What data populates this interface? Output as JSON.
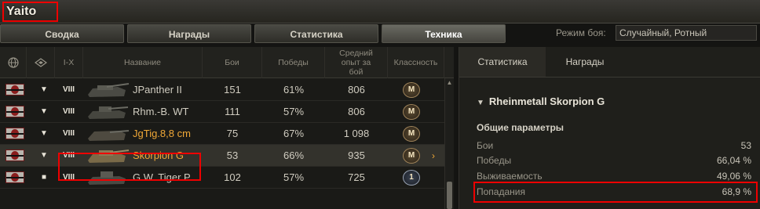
{
  "player": {
    "name": "Yaito"
  },
  "tabs": [
    {
      "label": "Сводка"
    },
    {
      "label": "Награды"
    },
    {
      "label": "Статистика"
    },
    {
      "label": "Техника"
    }
  ],
  "battle_mode": {
    "label": "Режим боя:",
    "value": "Случайный, Ротный"
  },
  "table": {
    "headers": {
      "tier": "I-X",
      "name": "Название",
      "battles": "Бои",
      "wins": "Победы",
      "avg_xp": "Средний опыт за бой",
      "mastery": "Классность"
    },
    "rows": [
      {
        "tier": "VIII",
        "name": "JPanther II",
        "battles": "151",
        "wins": "61%",
        "avg_xp": "806",
        "mastery": "M",
        "premium": false,
        "expand_icon": "triangle-down"
      },
      {
        "tier": "VIII",
        "name": "Rhm.-B. WT",
        "battles": "111",
        "wins": "57%",
        "avg_xp": "806",
        "mastery": "M",
        "premium": false,
        "expand_icon": "triangle-down"
      },
      {
        "tier": "VIII",
        "name": "JgTig.8,8 cm",
        "battles": "75",
        "wins": "67%",
        "avg_xp": "1 098",
        "mastery": "M",
        "premium": true,
        "expand_icon": "triangle-down"
      },
      {
        "tier": "VIII",
        "name": "Skorpion G",
        "battles": "53",
        "wins": "66%",
        "avg_xp": "935",
        "mastery": "M",
        "premium": true,
        "expand_icon": "triangle-down",
        "selected": true
      },
      {
        "tier": "VIII",
        "name": "G.W. Tiger P",
        "battles": "102",
        "wins": "57%",
        "avg_xp": "725",
        "mastery": "1",
        "premium": false,
        "expand_icon": "square"
      }
    ]
  },
  "panel": {
    "tabs": [
      {
        "label": "Статистика"
      },
      {
        "label": "Награды"
      }
    ],
    "vehicle_title": "Rheinmetall Skorpion G",
    "section_title": "Общие параметры",
    "stats": [
      {
        "label": "Бои",
        "value": "53"
      },
      {
        "label": "Победы",
        "value": "66,04 %"
      },
      {
        "label": "Выживаемость",
        "value": "49,06 %"
      },
      {
        "label": "Попадания",
        "value": "68,9 %"
      }
    ]
  },
  "colors": {
    "highlight": "#ee0000",
    "premium_name": "#f0a837",
    "background": "#141412"
  }
}
